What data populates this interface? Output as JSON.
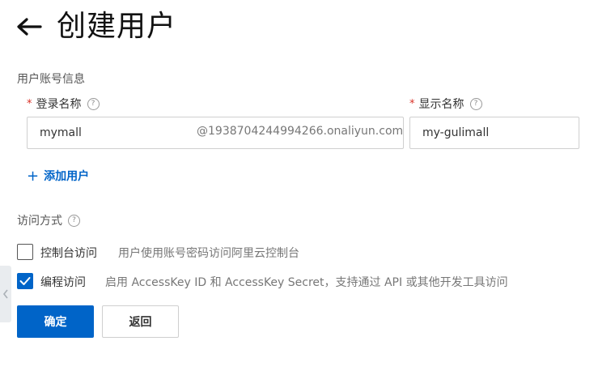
{
  "header": {
    "title": "创建用户"
  },
  "account_section": {
    "title": "用户账号信息"
  },
  "login_name": {
    "label": "登录名称",
    "value": "mymall",
    "suffix": "@1938704244994266.onaliyun.com"
  },
  "display_name": {
    "label": "显示名称",
    "value": "my-gulimall"
  },
  "add_user": {
    "label": "添加用户"
  },
  "access_section": {
    "title": "访问方式"
  },
  "access_options": [
    {
      "label": "控制台访问",
      "desc": "用户使用账号密码访问阿里云控制台",
      "checked": false
    },
    {
      "label": "编程访问",
      "desc": "启用 AccessKey ID 和 AccessKey Secret，支持通过 API 或其他开发工具访问",
      "checked": true
    }
  ],
  "buttons": {
    "confirm": "确定",
    "back": "返回"
  },
  "required_mark": "*",
  "help_glyph": "?",
  "colors": {
    "primary": "#0064c8",
    "required": "#d93026",
    "border": "#cfcfcf"
  }
}
